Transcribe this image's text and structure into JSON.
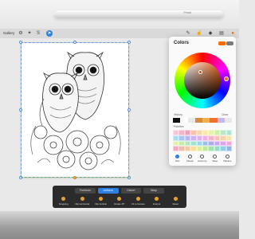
{
  "pencil": {
    "brand": "Pencil"
  },
  "toolbar": {
    "gallery_label": "Gallery",
    "left_icons": [
      "wrench-icon",
      "magic-wand-icon",
      "s-selection-icon",
      "arrow-transform-icon"
    ],
    "right_icons": [
      "brush-icon",
      "smudge-icon",
      "eraser-icon",
      "layers-icon"
    ]
  },
  "colors_panel": {
    "title": "Colors",
    "current_color": "#ff6a00",
    "previous_color": "#7a7a7a",
    "history_label": "History",
    "clear_label": "Clear",
    "palettes_label": "Palettes",
    "history_colors": [
      "#111111",
      "#ffffff",
      "#e8e8e8",
      "#d9893b",
      "#f2b04c",
      "#f36f2c",
      "#c7b6f2",
      "#e8e8e8"
    ],
    "palette_colors": [
      "#f8c6d8",
      "#f7b3c9",
      "#f39fb9",
      "#f7c3a8",
      "#f9d7a4",
      "#fbe8a3",
      "#e7f3a6",
      "#cdefa8",
      "#b8e9c2",
      "#aee3d9",
      "#a9dcf0",
      "#a9c7f4",
      "#b7b5f4",
      "#cdb2f2",
      "#e2b0ef",
      "#f0b0e2",
      "#f6b3cf",
      "#f6c3b5",
      "#f8d3a8",
      "#f9e6a6",
      "#e2f2a5",
      "#c6eda8",
      "#ade6bf",
      "#a0e0d5",
      "#98d6ee",
      "#9fbdf2",
      "#b0aaf3",
      "#c8a5f1",
      "#dfa2ec",
      "#f0a5dd",
      "#f4a8c4",
      "#f4bcac",
      "#f6cc9c",
      "#f7df9b",
      "#dcef99",
      "#bfe99b",
      "#a3e2b3",
      "#94dbcb",
      "#8dcfe9",
      "#93b3ee"
    ],
    "tabs": [
      {
        "label": "Disc",
        "icon": "disc-icon"
      },
      {
        "label": "Classic",
        "icon": "classic-icon"
      },
      {
        "label": "Harmony",
        "icon": "harmony-icon"
      },
      {
        "label": "Value",
        "icon": "value-icon"
      },
      {
        "label": "Palettes",
        "icon": "palettes-icon"
      }
    ]
  },
  "bottom_bar": {
    "modes": [
      "Freeform",
      "Uniform",
      "Distort",
      "Warp"
    ],
    "active_mode": "Uniform",
    "actions": [
      "Snapping",
      "Flip Horizontal",
      "Flip Vertical",
      "Rotate 45°",
      "Fit to Canvas",
      "Interpol.",
      "Reset"
    ]
  },
  "artwork": {
    "subject": "owls-line-art"
  }
}
